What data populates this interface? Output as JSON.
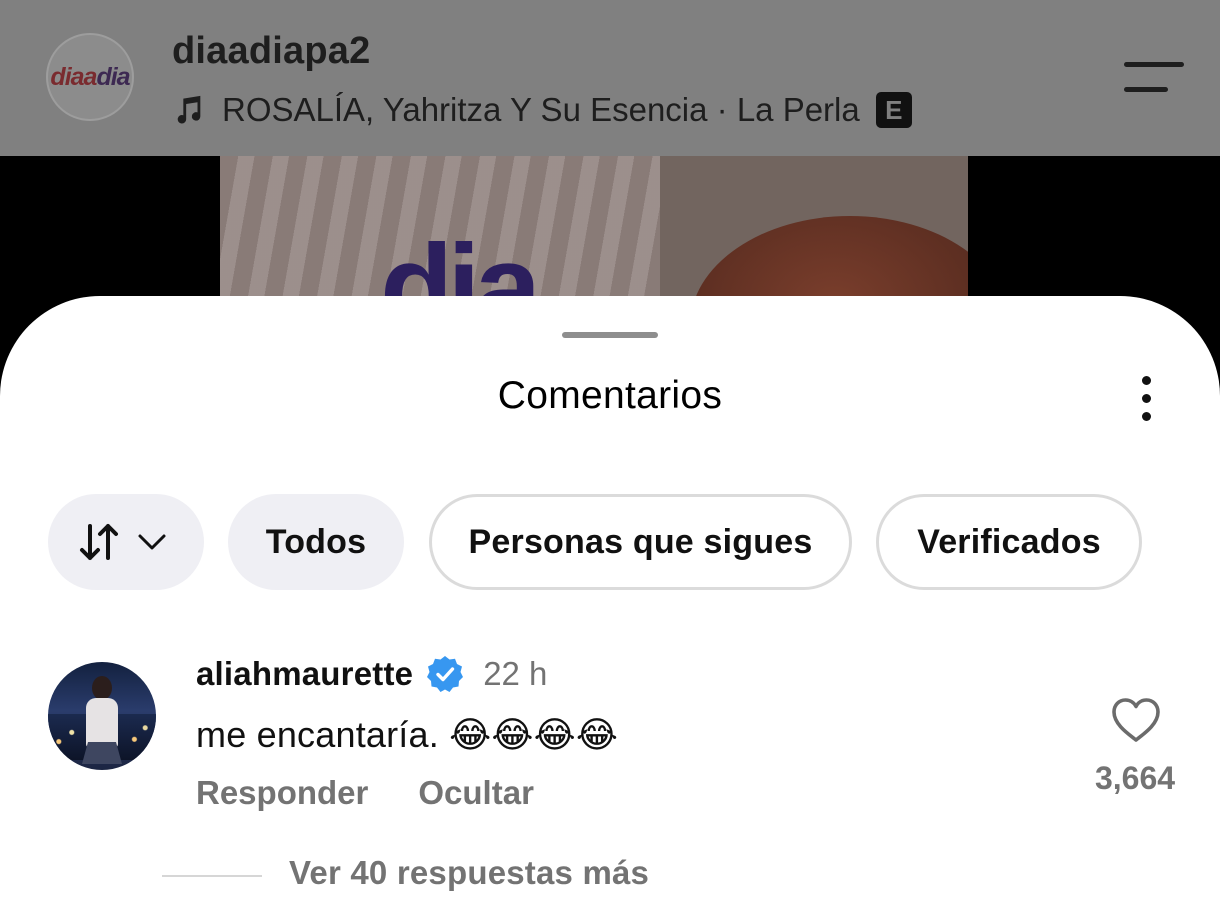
{
  "header": {
    "username": "diaadiapa2",
    "logo_text_a": "dia",
    "logo_text_b": "a",
    "logo_text_c": "dia",
    "music_track": "ROSALÍA, Yahritza Y Su Esencia · La Perla",
    "explicit_badge": "E",
    "icons": [
      "music-note-icon",
      "hamburger-menu-icon"
    ]
  },
  "sheet": {
    "title": "Comentarios",
    "icons": [
      "more-options-icon"
    ]
  },
  "filters": {
    "sort_icon": "sort-arrows-icon",
    "all": "Todos",
    "following": "Personas que sigues",
    "verified": "Verificados"
  },
  "comment": {
    "username": "aliahmaurette",
    "time": "22 h",
    "text": "me encantaría. 😂😂😂😂",
    "reply": "Responder",
    "hide": "Ocultar",
    "likes": "3,664",
    "more_replies": "Ver 40 respuestas más",
    "icons": [
      "verified-badge-icon",
      "heart-icon"
    ]
  },
  "colors": {
    "accent_verified": "#3797f0",
    "secondary_text": "#737373",
    "chip_bg": "#efeff4"
  }
}
